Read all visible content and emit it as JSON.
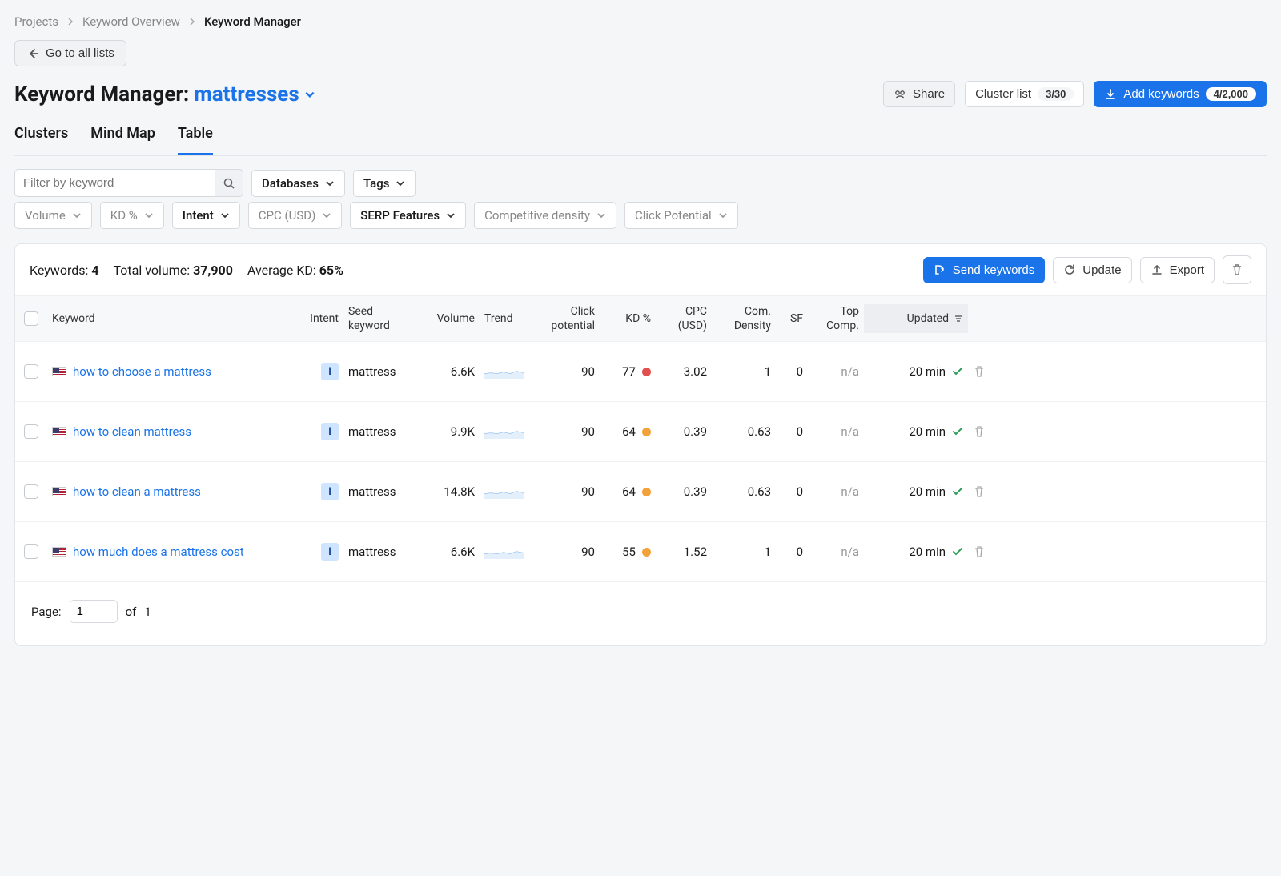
{
  "breadcrumb": {
    "items": [
      "Projects",
      "Keyword Overview",
      "Keyword Manager"
    ]
  },
  "back_button": "Go to all lists",
  "title": {
    "prefix": "Keyword Manager:",
    "list_name": "mattresses"
  },
  "header_actions": {
    "share": "Share",
    "cluster_list": "Cluster list",
    "cluster_count": "3/30",
    "add_keywords": "Add keywords",
    "add_count": "4/2,000"
  },
  "tabs": [
    "Clusters",
    "Mind Map",
    "Table"
  ],
  "active_tab": 2,
  "filters": {
    "search_placeholder": "Filter by keyword",
    "databases": "Databases",
    "tags": "Tags",
    "volume": "Volume",
    "kd": "KD %",
    "intent": "Intent",
    "cpc": "CPC (USD)",
    "serp": "SERP Features",
    "comp": "Competitive density",
    "click": "Click Potential"
  },
  "stats": {
    "keywords_label": "Keywords:",
    "keywords_value": "4",
    "volume_label": "Total volume:",
    "volume_value": "37,900",
    "kd_label": "Average KD:",
    "kd_value": "65%"
  },
  "card_actions": {
    "send": "Send keywords",
    "update": "Update",
    "export": "Export"
  },
  "columns": {
    "keyword": "Keyword",
    "intent": "Intent",
    "seed": "Seed keyword",
    "volume": "Volume",
    "trend": "Trend",
    "click_potential": "Click potential",
    "kd": "KD %",
    "cpc": "CPC (USD)",
    "com_density": "Com. Density",
    "sf": "SF",
    "top_comp": "Top Comp.",
    "updated": "Updated"
  },
  "rows": [
    {
      "keyword": "how to choose a mattress",
      "intent": "I",
      "seed": "mattress",
      "volume": "6.6K",
      "click_potential": "90",
      "kd": "77",
      "kd_color": "red",
      "cpc": "3.02",
      "com_density": "1",
      "sf": "0",
      "top_comp": "n/a",
      "updated": "20 min"
    },
    {
      "keyword": "how to clean mattress",
      "intent": "I",
      "seed": "mattress",
      "volume": "9.9K",
      "click_potential": "90",
      "kd": "64",
      "kd_color": "orange",
      "cpc": "0.39",
      "com_density": "0.63",
      "sf": "0",
      "top_comp": "n/a",
      "updated": "20 min"
    },
    {
      "keyword": "how to clean a mattress",
      "intent": "I",
      "seed": "mattress",
      "volume": "14.8K",
      "click_potential": "90",
      "kd": "64",
      "kd_color": "orange",
      "cpc": "0.39",
      "com_density": "0.63",
      "sf": "0",
      "top_comp": "n/a",
      "updated": "20 min"
    },
    {
      "keyword": "how much does a mattress cost",
      "intent": "I",
      "seed": "mattress",
      "volume": "6.6K",
      "click_potential": "90",
      "kd": "55",
      "kd_color": "orange",
      "cpc": "1.52",
      "com_density": "1",
      "sf": "0",
      "top_comp": "n/a",
      "updated": "20 min"
    }
  ],
  "pagination": {
    "label": "Page:",
    "current": "1",
    "of_label": "of",
    "total": "1"
  }
}
